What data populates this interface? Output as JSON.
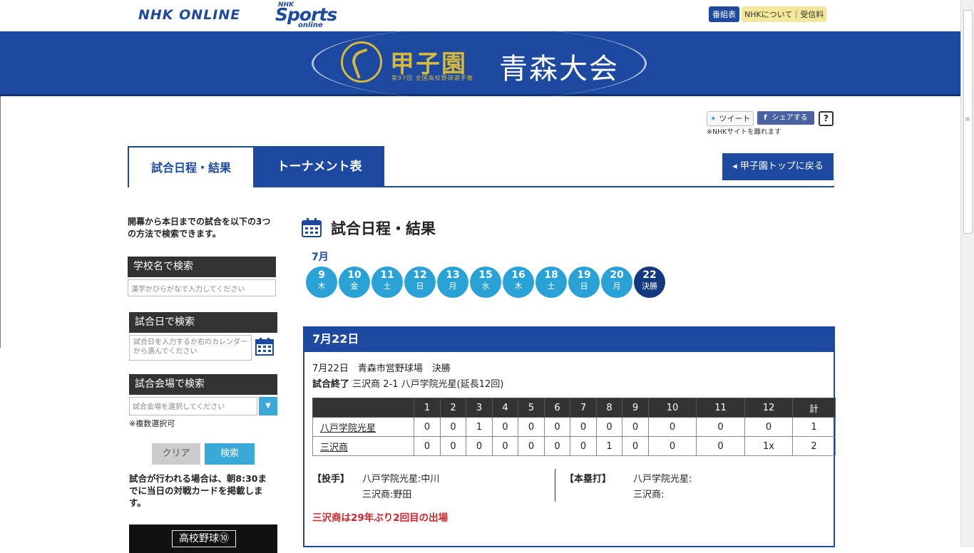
{
  "header": {
    "nhk_online": "NHK ONLINE",
    "sports_top": "NHK",
    "sports_main": "Sports",
    "sports_sub": "online",
    "bangumi": "番組表",
    "about": "NHKについて｜受信料"
  },
  "banner": {
    "koshien": "甲子園",
    "sub": "第97回 全国高校野球選手権",
    "region": "青森大会"
  },
  "share": {
    "tweet": "ツイート",
    "fb_icon": "f",
    "fb": "シェアする",
    "help": "?",
    "note": "※NHKサイトを離れます"
  },
  "tabs": {
    "schedule": "試合日程・結果",
    "tournament": "トーナメント表",
    "back": "甲子園トップに戻る"
  },
  "sidebar": {
    "intro": "開幕から本日までの試合を以下の3つの方法で検索できます。",
    "school_head": "学校名で検索",
    "school_placeholder": "漢字かひらがなで入力してください",
    "date_head": "試合日で検索",
    "date_placeholder": "試合日を入力するか右のカレンダーから選んでください",
    "venue_head": "試合会場で検索",
    "venue_placeholder": "試合会場を選択してください",
    "multi_note": "※複数選択可",
    "clear": "クリア",
    "search": "検索",
    "footer": "試合が行われる場合は、朝8:30までに当日の対戦カードを掲載します。",
    "img_label": "高校野球⑩"
  },
  "main": {
    "title": "試合日程・結果",
    "month": "7月",
    "dates": [
      {
        "d": "9",
        "w": "木"
      },
      {
        "d": "10",
        "w": "金"
      },
      {
        "d": "11",
        "w": "土"
      },
      {
        "d": "12",
        "w": "日"
      },
      {
        "d": "13",
        "w": "月"
      },
      {
        "d": "15",
        "w": "水"
      },
      {
        "d": "16",
        "w": "木"
      },
      {
        "d": "18",
        "w": "土"
      },
      {
        "d": "19",
        "w": "日"
      },
      {
        "d": "20",
        "w": "月"
      },
      {
        "d": "22",
        "w": "決勝"
      }
    ],
    "day_title": "7月22日",
    "game_info": "7月22日　青森市営野球場　決勝",
    "result_label": "試合終了",
    "result_text": "三沢商 2-1 八戸学院光星(延長12回)",
    "score_headers": [
      "",
      "1",
      "2",
      "3",
      "4",
      "5",
      "6",
      "7",
      "8",
      "9",
      "10",
      "11",
      "12",
      "計"
    ],
    "score_rows": [
      [
        "八戸学院光星",
        "0",
        "0",
        "1",
        "0",
        "0",
        "0",
        "0",
        "0",
        "0",
        "0",
        "0",
        "0",
        "1"
      ],
      [
        "三沢商",
        "0",
        "0",
        "0",
        "0",
        "0",
        "0",
        "0",
        "1",
        "0",
        "0",
        "0",
        "1x",
        "2"
      ]
    ],
    "pitcher_label": "【投手】",
    "pitcher_1": "八戸学院光星:中川",
    "pitcher_2": "三沢商:野田",
    "hr_label": "【本塁打】",
    "hr_1": "八戸学院光星:",
    "hr_2": "三沢商:",
    "note": "三沢商は29年ぶり2回目の出場"
  },
  "colors": {
    "brand_blue": "#1d4aa0",
    "date_blue": "#2aa2d6",
    "date_active": "#12397f",
    "gold": "#d5b93a",
    "note_red": "#d2232a"
  }
}
